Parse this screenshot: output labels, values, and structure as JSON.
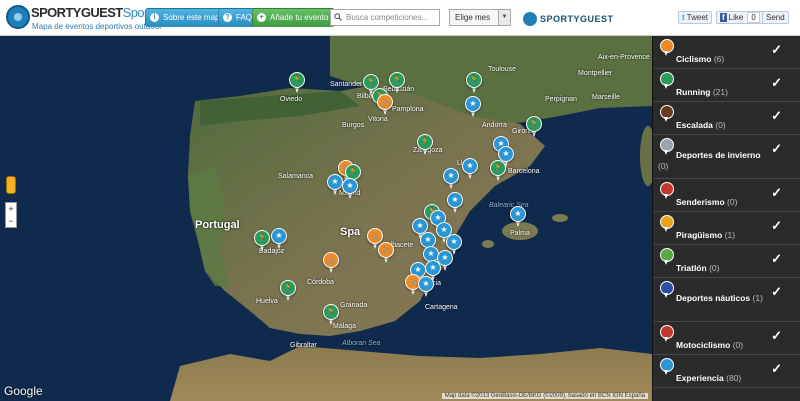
{
  "header": {
    "brand_part1": "SPORTYGUEST",
    "brand_part2": "SportsMap",
    "tagline": "Mapa de eventos deportivos outdoor",
    "about_button": "Sobre este mapa",
    "faq_button": "FAQ",
    "add_event_button": "Añade tu evento",
    "search_placeholder": "Busca competiciones...",
    "month_select": "Elige mes",
    "partner_logo": "SPORTYGUEST",
    "tweet_label": "Tweet",
    "like_label": "Like",
    "like_count": "0",
    "send_label": "Send"
  },
  "map": {
    "labels": {
      "oviedo": "Oviedo",
      "santander": "Santander",
      "bilbao": "Bilbao",
      "sebastian": "Sebastián",
      "pamplona": "Pamplona",
      "vitoria": "Vitoria",
      "burgos": "Burgos",
      "andorra": "Andorra",
      "girona": "Girona",
      "zaragoza": "Zaragoza",
      "lleida": "Lleida",
      "barcelona": "Barcelona",
      "salamanca": "Salamanca",
      "madrid": "Madrid",
      "portugal": "Portugal",
      "spain": "Spa",
      "albacete": "Albacete",
      "badajoz": "Badajoz",
      "cordoba": "Córdoba",
      "murcia": "Murcia",
      "cartagena": "Cartagena",
      "granada": "Granada",
      "malaga": "Málaga",
      "huelva": "Huelva",
      "gibraltar": "Gibraltar",
      "alboran": "Alboran Sea",
      "balearic": "Balearic Sea",
      "palma": "Palma",
      "toulouse": "Toulouse",
      "montpellier": "Montpellier",
      "perpignan": "Perpignan",
      "aix": "Aix-en-Provence",
      "marseille": "Marseille"
    },
    "google_logo": "Google",
    "attribution": "Map data ©2013 GeoBasis-DE/BKG (©2009), basado en BCN IGN España",
    "zoom_in": "+",
    "zoom_out": "−"
  },
  "sidebar": {
    "categories": [
      {
        "label": "Ciclismo",
        "count": "(6)",
        "color": "#f08a24",
        "icon": "bike-icon"
      },
      {
        "label": "Running",
        "count": "(21)",
        "color": "#2b9a5b",
        "icon": "running-icon"
      },
      {
        "label": "Escalada",
        "count": "(0)",
        "color": "#6b3b1f",
        "icon": "climbing-icon"
      },
      {
        "label": "Deportes de invierno",
        "count": "(0)",
        "color": "#9aa3ab",
        "icon": "snowflake-icon"
      },
      {
        "label": "Senderismo",
        "count": "(0)",
        "color": "#c0392b",
        "icon": "hiking-icon"
      },
      {
        "label": "Piragüismo",
        "count": "(1)",
        "color": "#e8a21c",
        "icon": "kayak-icon"
      },
      {
        "label": "Triatlón",
        "count": "(0)",
        "color": "#57a845",
        "icon": "triathlon-icon"
      },
      {
        "label": "Deportes náuticos",
        "count": "(1)",
        "color": "#2a4fa5",
        "icon": "sailing-icon"
      },
      {
        "label": "Motociclismo",
        "count": "(0)",
        "color": "#c0392b",
        "icon": "motorbike-icon"
      },
      {
        "label": "Experiencia",
        "count": "(80)",
        "color": "#2a96d4",
        "icon": "star-icon"
      }
    ],
    "check_glyph": "✓"
  }
}
